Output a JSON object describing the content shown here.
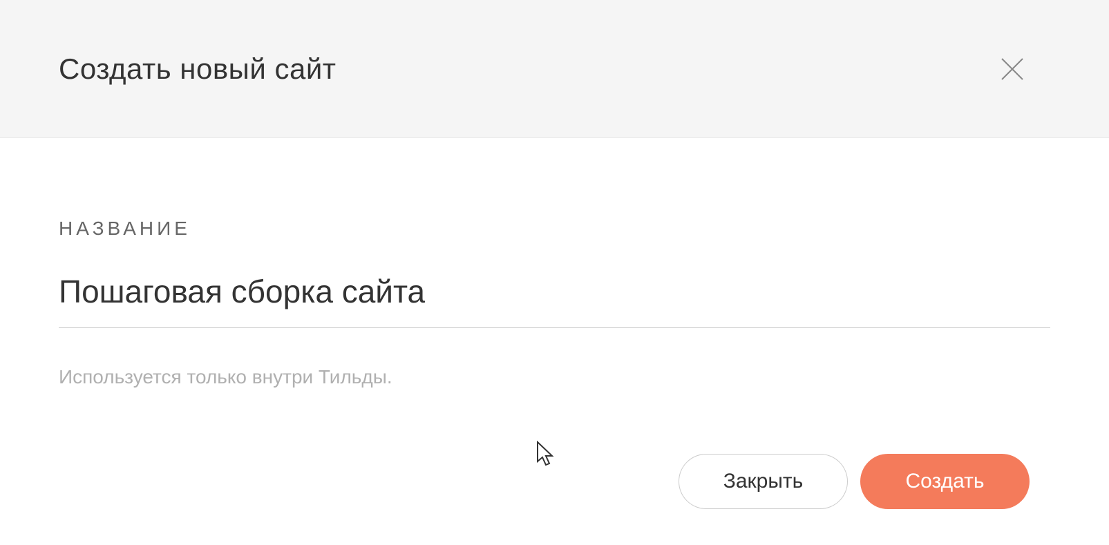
{
  "modal": {
    "title": "Создать новый сайт",
    "close_icon": "close-icon"
  },
  "form": {
    "field_label": "НАЗВАНИЕ",
    "input_value": "Пошаговая сборка сайта",
    "help_text": "Используется только внутри Тильды."
  },
  "buttons": {
    "cancel_label": "Закрыть",
    "submit_label": "Создать"
  },
  "colors": {
    "primary": "#f47b5b",
    "header_bg": "#f5f5f5",
    "text_primary": "#333333",
    "text_muted": "#b0b0b0"
  }
}
